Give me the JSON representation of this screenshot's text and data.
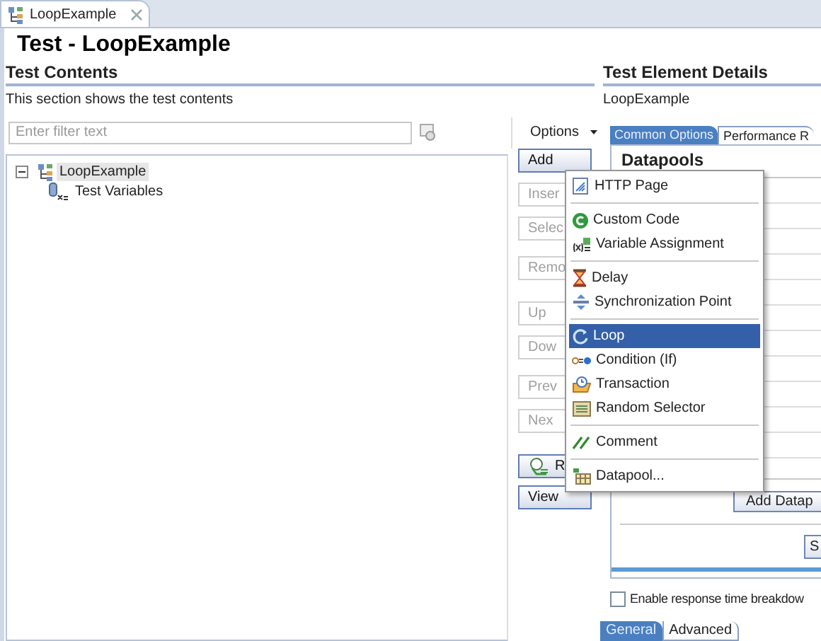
{
  "editor_tab": {
    "title": "LoopExample"
  },
  "title": "Test - LoopExample",
  "test_contents": {
    "heading": "Test Contents",
    "description": "This section shows the test contents",
    "filter": {
      "placeholder": "Enter filter text"
    },
    "options_label": "Options",
    "tree": [
      {
        "label": "LoopExample",
        "expanded": true,
        "selected": true,
        "children": [
          {
            "label": "Test Variables",
            "selected": false
          }
        ]
      }
    ],
    "buttons": [
      {
        "label": "Add",
        "disabled": false,
        "kind": "text"
      },
      {
        "label": "Inser",
        "disabled": true,
        "kind": "text"
      },
      {
        "label": "Selec",
        "disabled": true,
        "kind": "text"
      },
      {
        "label": "Remo",
        "disabled": true,
        "kind": "text"
      },
      {
        "label": "Up",
        "disabled": true,
        "kind": "text"
      },
      {
        "label": "Dow",
        "disabled": true,
        "kind": "text"
      },
      {
        "label": "Prev",
        "disabled": true,
        "kind": "text"
      },
      {
        "label": "Nex",
        "disabled": true,
        "kind": "text"
      },
      {
        "label": "R",
        "disabled": false,
        "kind": "icon"
      },
      {
        "label": "View",
        "disabled": false,
        "kind": "text"
      }
    ]
  },
  "details": {
    "heading": "Test Element Details",
    "element": "LoopExample",
    "tabs": [
      {
        "label": "Common Options",
        "selected": true
      },
      {
        "label": "Performance R",
        "selected": false
      }
    ],
    "section": "Datapools",
    "add_button": "Add Datap",
    "second_button": "S",
    "checkbox": {
      "label": "Enable response time breakdow",
      "checked": false
    },
    "bottom_tabs": [
      {
        "label": "General",
        "selected": true
      },
      {
        "label": "Advanced",
        "selected": false
      }
    ]
  },
  "menu": {
    "groups": [
      [
        {
          "label": "HTTP Page",
          "selected": false
        }
      ],
      [
        {
          "label": "Custom Code",
          "selected": false
        },
        {
          "label": "Variable Assignment",
          "selected": false
        }
      ],
      [
        {
          "label": "Delay",
          "selected": false
        },
        {
          "label": "Synchronization Point",
          "selected": false
        }
      ],
      [
        {
          "label": "Loop",
          "selected": true
        },
        {
          "label": "Condition (If)",
          "selected": false
        },
        {
          "label": "Transaction",
          "selected": false
        },
        {
          "label": "Random Selector",
          "selected": false
        }
      ],
      [
        {
          "label": "Comment",
          "selected": false
        }
      ],
      [
        {
          "label": "Datapool...",
          "selected": false
        }
      ]
    ]
  }
}
